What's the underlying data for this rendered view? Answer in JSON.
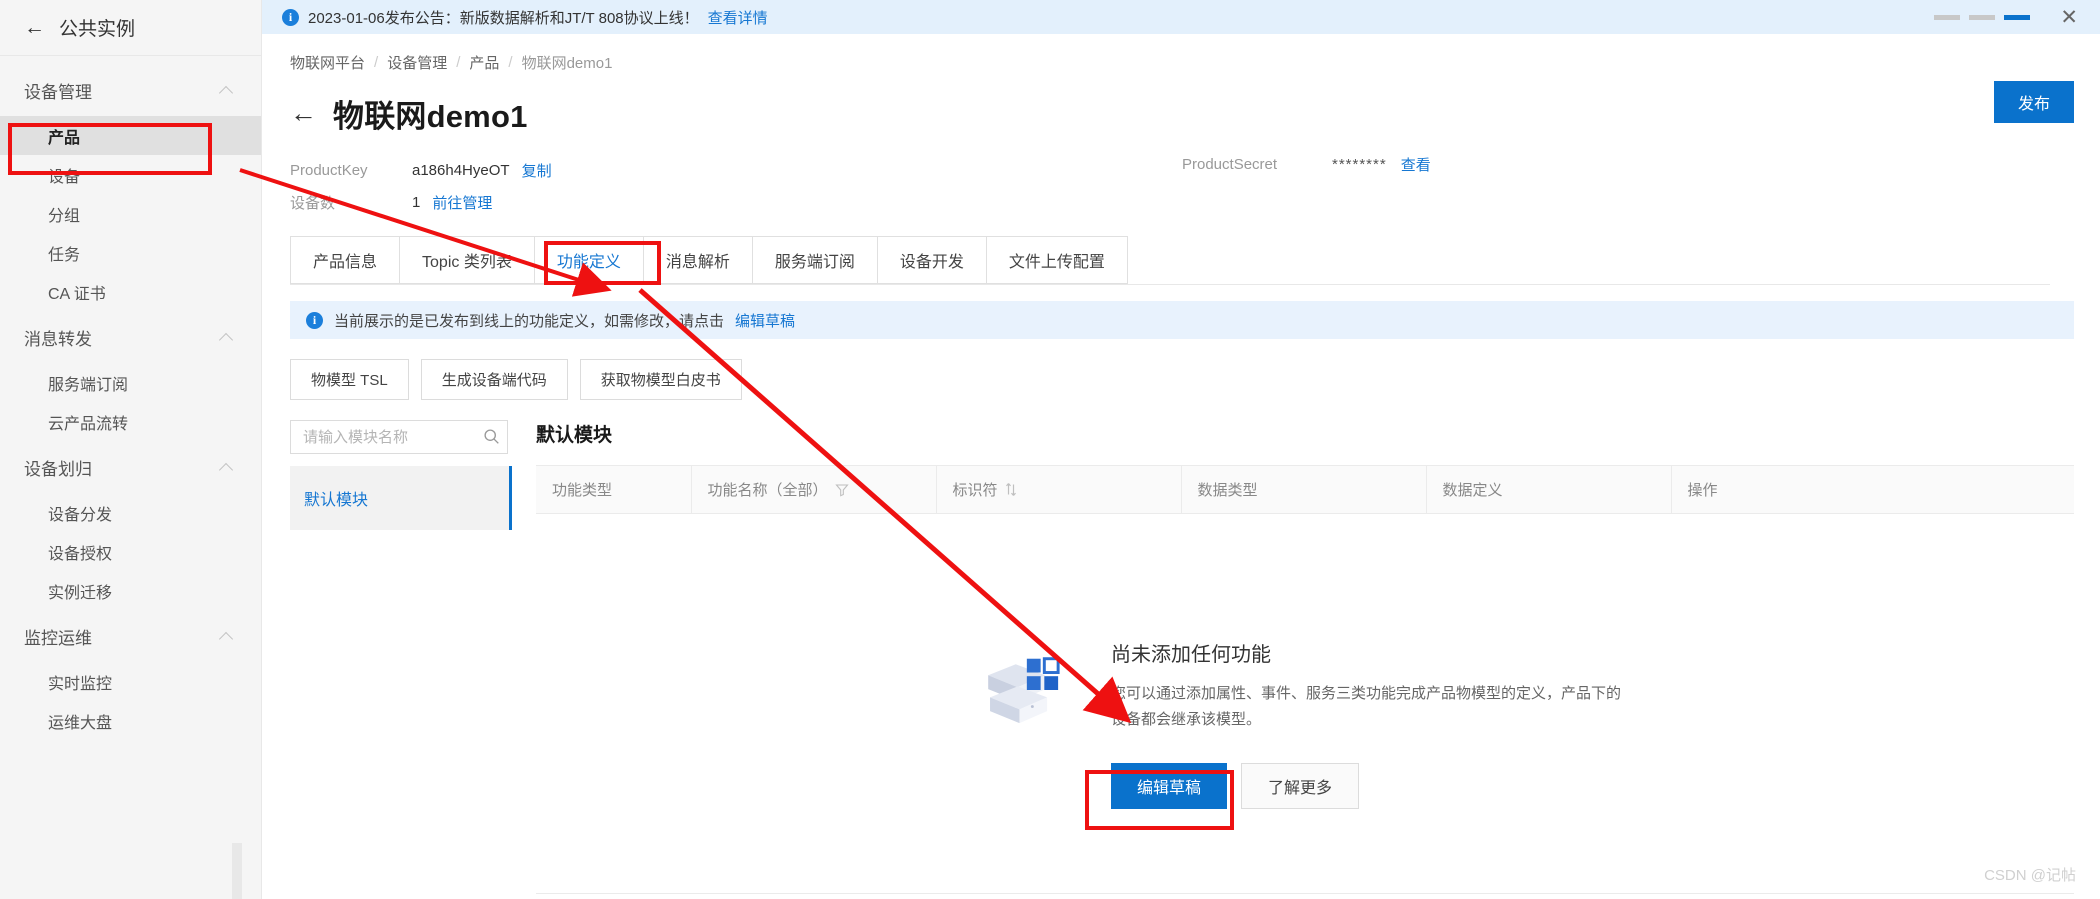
{
  "sidebar": {
    "instance": {
      "label": "公共实例",
      "back_icon": "arrow-left-icon"
    },
    "groups": [
      {
        "title": "设备管理",
        "collapse_icon": "chevron-up-icon",
        "items": [
          {
            "label": "产品",
            "active": true
          },
          {
            "label": "设备",
            "active": false
          },
          {
            "label": "分组",
            "active": false
          },
          {
            "label": "任务",
            "active": false
          },
          {
            "label": "CA 证书",
            "active": false
          }
        ]
      },
      {
        "title": "消息转发",
        "collapse_icon": "chevron-up-icon",
        "items": [
          {
            "label": "服务端订阅",
            "active": false
          },
          {
            "label": "云产品流转",
            "active": false
          }
        ]
      },
      {
        "title": "设备划归",
        "collapse_icon": "chevron-up-icon",
        "items": [
          {
            "label": "设备分发",
            "active": false
          },
          {
            "label": "设备授权",
            "active": false
          },
          {
            "label": "实例迁移",
            "active": false
          }
        ]
      },
      {
        "title": "监控运维",
        "collapse_icon": "chevron-up-icon",
        "items": [
          {
            "label": "实时监控",
            "active": false
          },
          {
            "label": "运维大盘",
            "active": false
          }
        ]
      }
    ]
  },
  "notice": {
    "icon": "info-circle-icon",
    "text": "2023-01-06发布公告：新版数据解析和JT/T 808协议上线！",
    "link": "查看详情",
    "carousel": {
      "count": 3,
      "active_index": 2
    },
    "close_icon": "close-icon"
  },
  "breadcrumb": {
    "items": [
      "物联网平台",
      "设备管理",
      "产品",
      "物联网demo1"
    ],
    "separator": "/"
  },
  "header": {
    "back_icon": "arrow-left-icon",
    "title": "物联网demo1",
    "publish_button": "发布"
  },
  "meta": {
    "product_key_label": "ProductKey",
    "product_key_value": "a186h4HyeOT",
    "product_key_copy": "复制",
    "device_count_label": "设备数",
    "device_count_value": "1",
    "device_manage_link": "前往管理",
    "product_secret_label": "ProductSecret",
    "product_secret_value": "********",
    "product_secret_view": "查看"
  },
  "tabs": [
    {
      "label": "产品信息",
      "active": false
    },
    {
      "label": "Topic 类列表",
      "active": false
    },
    {
      "label": "功能定义",
      "active": true
    },
    {
      "label": "消息解析",
      "active": false
    },
    {
      "label": "服务端订阅",
      "active": false
    },
    {
      "label": "设备开发",
      "active": false
    },
    {
      "label": "文件上传配置",
      "active": false
    }
  ],
  "alert": {
    "icon": "info-circle-icon",
    "text": "当前展示的是已发布到线上的功能定义，如需修改，请点击",
    "link": "编辑草稿"
  },
  "toolbar": {
    "buttons": [
      "物模型 TSL",
      "生成设备端代码",
      "获取物模型白皮书"
    ]
  },
  "module_panel": {
    "search_placeholder": "请输入模块名称",
    "search_value": "",
    "search_icon": "search-icon",
    "items": [
      {
        "label": "默认模块",
        "active": true
      }
    ]
  },
  "table": {
    "title": "默认模块",
    "columns": [
      {
        "label": "功能类型",
        "icon": ""
      },
      {
        "label": "功能名称（全部）",
        "icon": "filter-icon"
      },
      {
        "label": "标识符",
        "icon": "sort-icon"
      },
      {
        "label": "数据类型",
        "icon": ""
      },
      {
        "label": "数据定义",
        "icon": ""
      },
      {
        "label": "操作",
        "icon": ""
      }
    ]
  },
  "empty_state": {
    "illustration": "empty-box-icon",
    "title": "尚未添加任何功能",
    "description": "您可以通过添加属性、事件、服务三类功能完成产品物模型的定义，产品下的设备都会继承该模型。",
    "primary_button": "编辑草稿",
    "secondary_button": "了解更多"
  },
  "watermark": "CSDN @记帖",
  "colors": {
    "accent": "#0a72cc",
    "link": "#1677d2",
    "annotation": "#e60000",
    "notice_bg": "#e3f0fc",
    "alert_bg": "#e8f2fd"
  }
}
